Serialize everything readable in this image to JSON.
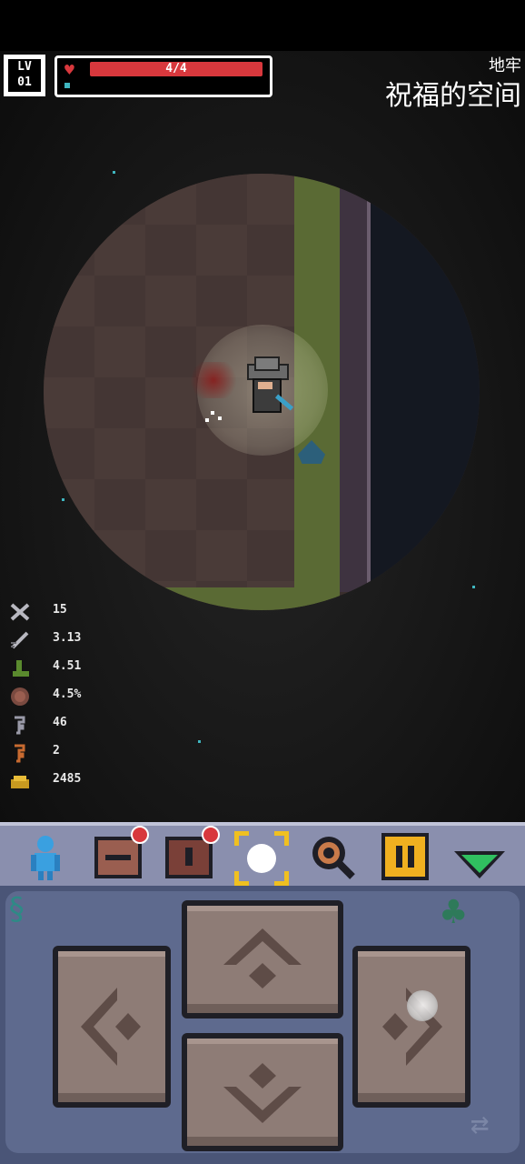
{
  "hud": {
    "level_line1": "LV",
    "level_line2": "01",
    "hp_text": "4/4",
    "hp_fraction": 1.0,
    "area_type": "地牢",
    "area_name": "祝福的空间"
  },
  "stats": [
    {
      "icon": "crossed-swords-icon",
      "value": "15"
    },
    {
      "icon": "sword-speed-icon",
      "value": "3.13"
    },
    {
      "icon": "boot-icon",
      "value": "4.51"
    },
    {
      "icon": "shield-icon",
      "value": "4.5%"
    },
    {
      "icon": "key-gray-icon",
      "value": "46"
    },
    {
      "icon": "key-orange-icon",
      "value": "2"
    },
    {
      "icon": "gold-coins-icon",
      "value": "2485"
    }
  ],
  "toolbar": [
    {
      "icon": "character-icon",
      "badge": false
    },
    {
      "icon": "inventory-chest-icon",
      "badge": true
    },
    {
      "icon": "backpack-icon",
      "badge": true
    },
    {
      "icon": "target-select-icon",
      "badge": false
    },
    {
      "icon": "magnifier-icon",
      "badge": false
    },
    {
      "icon": "pause-icon",
      "badge": false
    },
    {
      "icon": "collapse-arrow-icon",
      "badge": false
    }
  ],
  "colors": {
    "hp": "#d8383d",
    "toolbar": "#8a8fae",
    "pad": "#5e6a8e",
    "button": "#8e7c76"
  }
}
